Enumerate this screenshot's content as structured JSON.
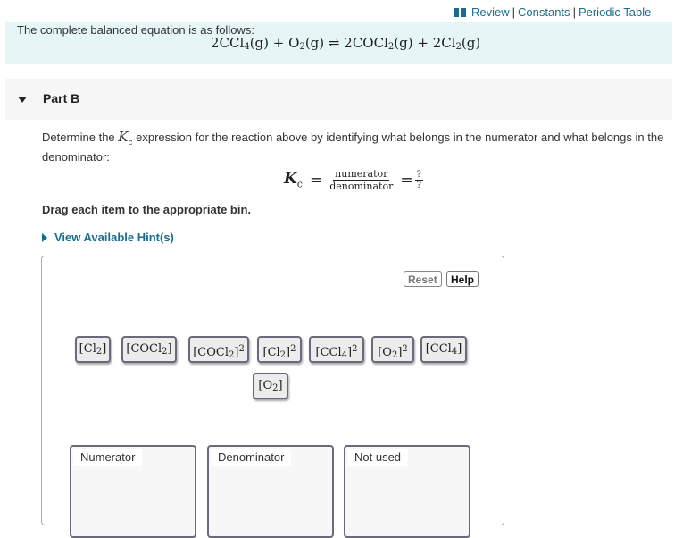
{
  "top_links": {
    "icon": "book-icon",
    "items": [
      "Review",
      "Constants",
      "Periodic Table"
    ],
    "separator": "|"
  },
  "intro": {
    "text": "The complete balanced equation is as follows:",
    "equation": {
      "reactants": [
        {
          "coef": "2",
          "formula": "CCl",
          "sub": "4",
          "state": "(g)"
        },
        {
          "coef": "",
          "formula": "O",
          "sub": "2",
          "state": "(g)"
        }
      ],
      "arrow": "⇌",
      "products": [
        {
          "coef": "2",
          "formula": "COCl",
          "sub": "2",
          "state": "(g)"
        },
        {
          "coef": "2",
          "formula": "Cl",
          "sub": "2",
          "state": "(g)"
        }
      ],
      "plus": "+"
    }
  },
  "part": {
    "label": "Part B",
    "expanded": true
  },
  "question": {
    "before": "Determine the ",
    "symbol": "K",
    "symbol_sub": "c",
    "after": " expression for the reaction above by identifying what belongs in the numerator and what belongs in the denominator:"
  },
  "kc_expression": {
    "symbol": "K",
    "symbol_sub": "c",
    "equals": "=",
    "numerator": "numerator",
    "denominator": "denominator",
    "q_num": "?",
    "q_den": "?"
  },
  "instruction": "Drag each item to the appropriate bin.",
  "hint_link": "View Available Hint(s)",
  "buttons": {
    "reset": "Reset",
    "help": "Help"
  },
  "tiles": [
    {
      "formula": "Cl",
      "sub": "2",
      "power": ""
    },
    {
      "formula": "COCl",
      "sub": "2",
      "power": ""
    },
    {
      "formula": "COCl",
      "sub": "2",
      "power": "2"
    },
    {
      "formula": "Cl",
      "sub": "2",
      "power": "2"
    },
    {
      "formula": "CCl",
      "sub": "4",
      "power": "2"
    },
    {
      "formula": "O",
      "sub": "2",
      "power": "2"
    },
    {
      "formula": "CCl",
      "sub": "4",
      "power": ""
    },
    {
      "formula": "O",
      "sub": "2",
      "power": ""
    }
  ],
  "bins": [
    {
      "label": "Numerator"
    },
    {
      "label": "Denominator"
    },
    {
      "label": "Not used"
    }
  ],
  "colors": {
    "link": "#1a6c8c",
    "intro_bg": "#e6f5f6",
    "part_bg": "#f6f6f6",
    "tile_bg": "#ececec",
    "tile_border": "#6a6a7a"
  }
}
